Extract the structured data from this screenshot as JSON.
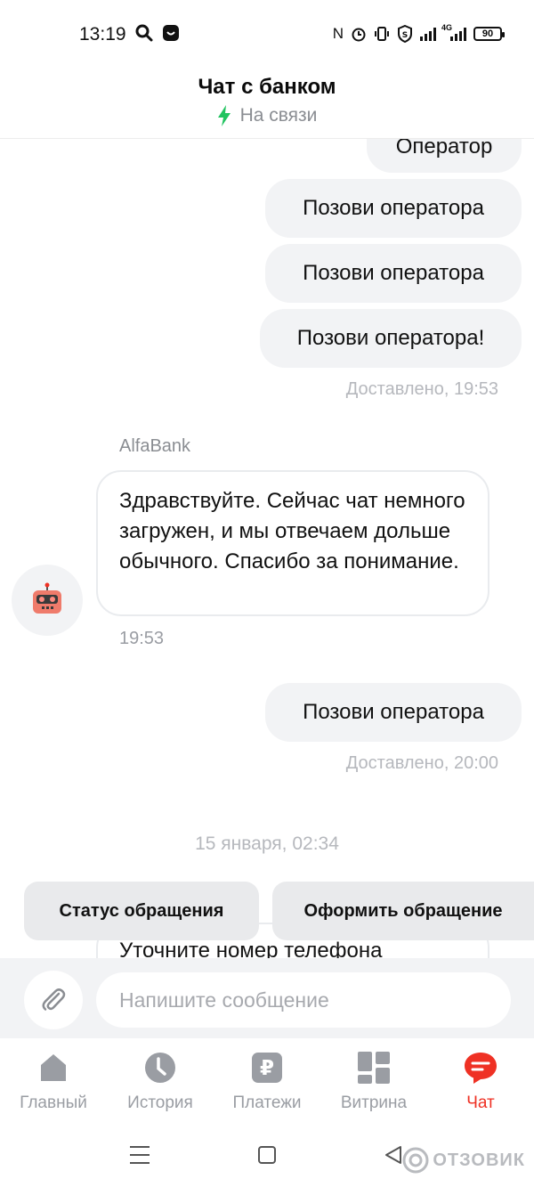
{
  "status_bar": {
    "time": "13:19",
    "battery": "90",
    "network": "4G"
  },
  "header": {
    "title": "Чат с банком",
    "status": "На связи",
    "status_color": "#21c35f"
  },
  "chat": {
    "outgoing_top": [
      {
        "text": "Оператор"
      },
      {
        "text": "Позови оператора"
      },
      {
        "text": "Позови оператора"
      },
      {
        "text": "Позови оператора!"
      }
    ],
    "delivered_1": "Доставлено, 19:53",
    "bot": {
      "sender": "AlfaBank",
      "text": "Здравствуйте. Сейчас чат немного загружен, и мы отвечаем дольше обычного. Спасибо за понимание.",
      "time": "19:53"
    },
    "outgoing_2": {
      "text": "Позови оператора"
    },
    "delivered_2": "Доставлено, 20:00",
    "date_separator": "15 января, 02:34",
    "partial_message": "Уточните номер телефона"
  },
  "quick_replies": [
    "Статус обращения",
    "Оформить обращение"
  ],
  "composer": {
    "placeholder": "Напишите сообщение"
  },
  "bottom_nav": {
    "items": [
      {
        "label": "Главный",
        "icon": "home-icon"
      },
      {
        "label": "История",
        "icon": "clock-icon"
      },
      {
        "label": "Платежи",
        "icon": "ruble-icon"
      },
      {
        "label": "Витрина",
        "icon": "grid-icon"
      },
      {
        "label": "Чат",
        "icon": "chat-icon",
        "active": true
      }
    ]
  },
  "watermark": "ОТЗОВИК",
  "colors": {
    "accent": "#ef3124",
    "bubble": "#f2f3f5",
    "muted": "#9a9da3"
  }
}
